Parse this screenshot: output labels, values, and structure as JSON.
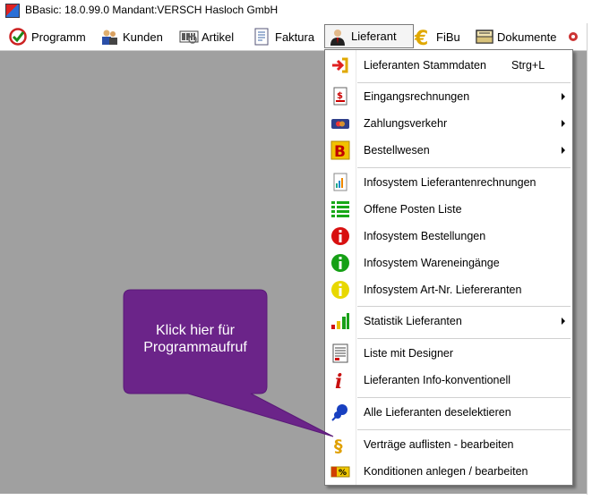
{
  "window": {
    "title": "BBasic: 18.0.99.0 Mandant:VERSCH Hasloch GmbH"
  },
  "menubar": [
    {
      "label": "Programm",
      "icon": "check-circle-icon"
    },
    {
      "label": "Kunden",
      "icon": "customers-icon"
    },
    {
      "label": "Artikel",
      "icon": "barcode-icon"
    },
    {
      "label": "Faktura",
      "icon": "invoice-icon"
    },
    {
      "label": "Lieferant",
      "icon": "supplier-person-icon",
      "active": true
    },
    {
      "label": "FiBu",
      "icon": "euro-icon"
    },
    {
      "label": "Dokumente",
      "icon": "document-tray-icon"
    }
  ],
  "dropdown": {
    "items": [
      {
        "label": "Lieferanten Stammdaten",
        "shortcut": "Strg+L",
        "icon": "enter-arrow-icon"
      },
      {
        "label": "Eingangsrechnungen",
        "submenu": true,
        "icon": "incoming-invoice-icon"
      },
      {
        "label": "Zahlungsverkehr",
        "submenu": true,
        "icon": "payment-card-icon"
      },
      {
        "label": "Bestellwesen",
        "submenu": true,
        "icon": "orders-b-icon"
      },
      {
        "label": "Infosystem Lieferantenrechnungen",
        "icon": "report-chart-icon"
      },
      {
        "label": "Offene Posten Liste",
        "icon": "list-icon"
      },
      {
        "label": "Infosystem Bestellungen",
        "icon": "info-red-icon"
      },
      {
        "label": "Infosystem Wareneingänge",
        "icon": "info-green-icon"
      },
      {
        "label": "Infosystem Art-Nr. Liefereranten",
        "icon": "info-yellow-icon"
      },
      {
        "label": "Statistik Lieferanten",
        "submenu": true,
        "icon": "bar-stats-icon"
      },
      {
        "label": "Liste mit Designer",
        "icon": "list-designer-icon"
      },
      {
        "label": "Lieferanten Info-konventionell",
        "icon": "info-italic-icon"
      },
      {
        "label": "Alle Lieferanten deselektieren",
        "icon": "pushpin-icon"
      },
      {
        "label": "Verträge auflisten - bearbeiten",
        "icon": "paragraph-icon"
      },
      {
        "label": "Konditionen anlegen / bearbeiten",
        "icon": "percent-conditions-icon"
      }
    ]
  },
  "callout": {
    "line1": "Klick hier für",
    "line2": "Programmaufruf",
    "color": "#6b2489"
  },
  "colors": {
    "desktop": "#a0a0a0",
    "menu_border": "#7a7a7a"
  }
}
